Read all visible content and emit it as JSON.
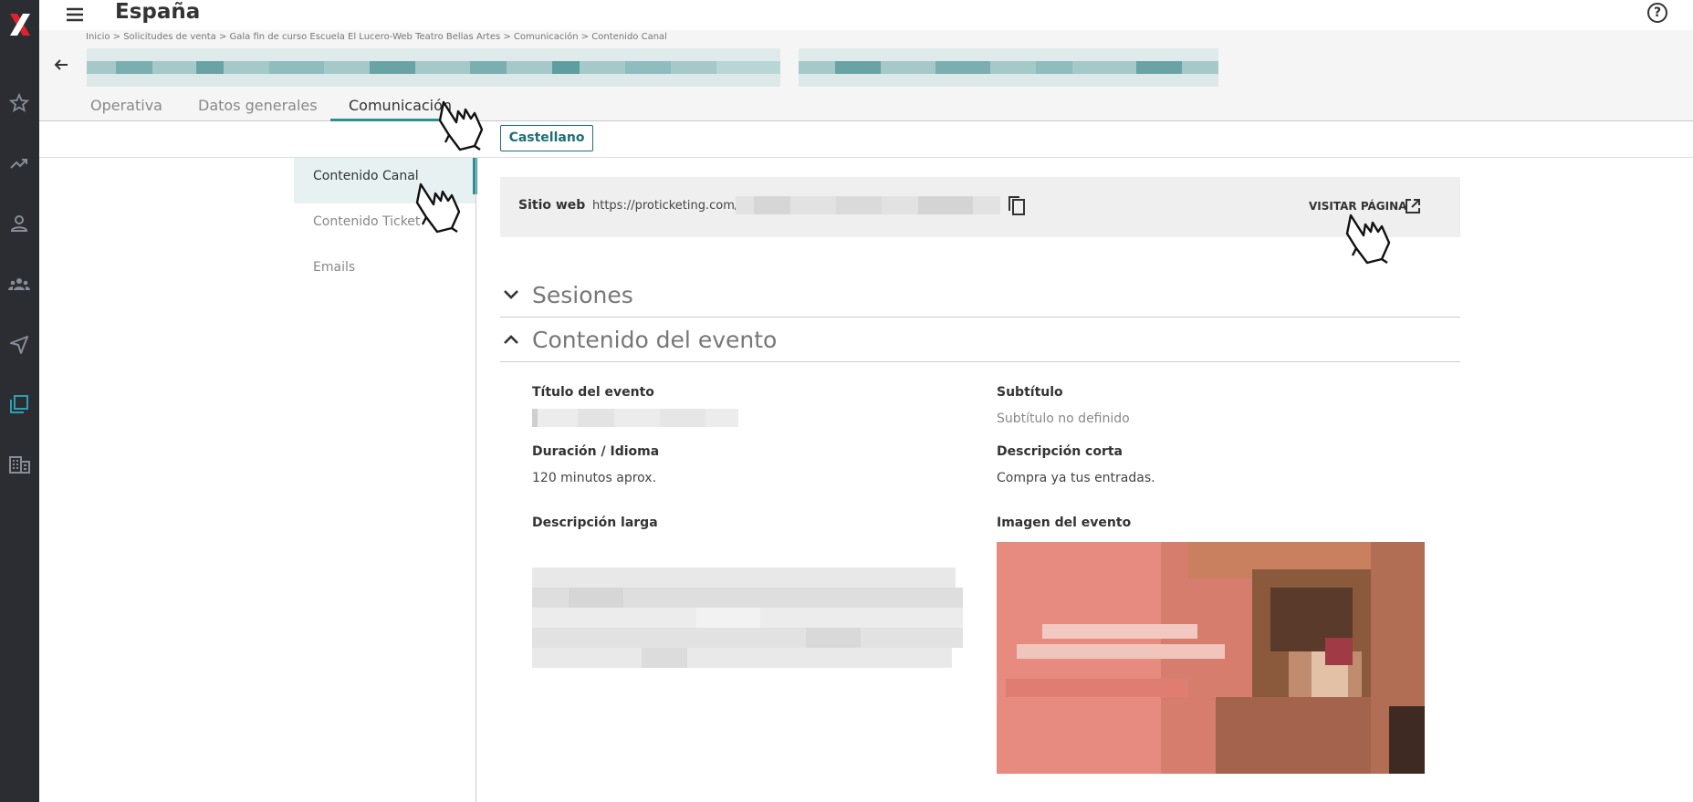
{
  "rail": {
    "logo": "X",
    "icons": [
      "star-icon",
      "trending-up-icon",
      "user-icon",
      "group-icon",
      "send-icon",
      "copy-stack-icon",
      "building-icon"
    ]
  },
  "topbar": {
    "title": "España",
    "help_symbol": "?"
  },
  "breadcrumb": "Inicio > Solicitudes de venta > Gala fin de curso Escuela El Lucero-Web Teatro Bellas Artes > Comunicación > Contenido Canal",
  "tabs": [
    {
      "label": "Operativa"
    },
    {
      "label": "Datos generales"
    },
    {
      "label": "Comunicación"
    }
  ],
  "language_button": "Castellano",
  "side_menu": [
    {
      "label": "Contenido Canal"
    },
    {
      "label": "Contenido Ticket"
    },
    {
      "label": "Emails"
    }
  ],
  "website": {
    "label": "Sitio web",
    "url": "https://proticketing.com/te",
    "visit_label": "VISITAR PÁGINA"
  },
  "accordions": {
    "sessions": "Sesiones",
    "event_content": "Contenido del evento"
  },
  "fields": {
    "event_title_label": "Título del evento",
    "subtitle_label": "Subtítulo",
    "subtitle_value": "Subtítulo no definido",
    "duration_label": "Duración / Idioma",
    "duration_value": "120 minutos aprox.",
    "short_desc_label": "Descripción corta",
    "short_desc_value": "Compra ya tus entradas.",
    "long_desc_label": "Descripción larga",
    "image_label": "Imagen del evento"
  },
  "colors": {
    "rail": "#2b2d33",
    "accent": "#2d8f91",
    "logo_red": "#e5202e"
  }
}
